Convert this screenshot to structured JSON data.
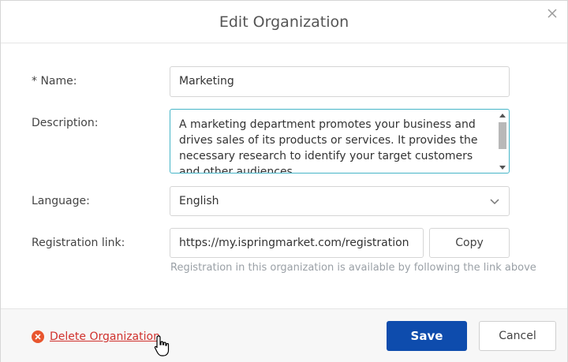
{
  "dialog": {
    "title": "Edit Organization",
    "close_icon": "close-icon"
  },
  "form": {
    "name_label": "* Name:",
    "name_value": "Marketing",
    "description_label": "Description:",
    "description_value": "A marketing department promotes your business and drives sales of its products or services. It provides the necessary research to identify your target customers and other audiences.",
    "language_label": "Language:",
    "language_value": "English",
    "language_icon": "chevron-down-icon",
    "registration_label": "Registration link:",
    "registration_value": "https://my.ispringmarket.com/registration",
    "copy_label": "Copy",
    "registration_hint": "Registration in this organization is available by following the link above"
  },
  "footer": {
    "delete_label": "Delete Organization",
    "delete_icon": "delete-circle-icon",
    "save_label": "Save",
    "cancel_label": "Cancel"
  },
  "colors": {
    "primary": "#0e4cad",
    "danger": "#d0312d",
    "focus": "#46b5c8"
  }
}
